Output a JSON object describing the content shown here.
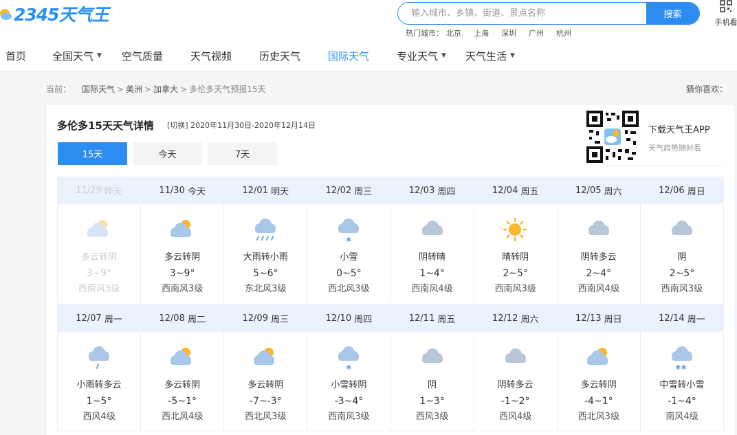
{
  "logo": {
    "text": "2345天气王"
  },
  "search": {
    "placeholder": "输入城市、乡镇、街道、景点名称",
    "button": "搜索"
  },
  "hot_cities": {
    "label": "热门城市：",
    "items": [
      "北京",
      "上海",
      "深圳",
      "广州",
      "杭州"
    ]
  },
  "mobile": {
    "label": "手机看"
  },
  "nav": {
    "items": [
      {
        "label": "首页",
        "caret": false,
        "active": false
      },
      {
        "label": "全国天气",
        "caret": true,
        "active": false
      },
      {
        "label": "空气质量",
        "caret": false,
        "active": false
      },
      {
        "label": "天气视频",
        "caret": false,
        "active": false
      },
      {
        "label": "历史天气",
        "caret": false,
        "active": false
      },
      {
        "label": "国际天气",
        "caret": false,
        "active": true
      },
      {
        "label": "专业天气",
        "caret": true,
        "active": false
      },
      {
        "label": "天气生活",
        "caret": true,
        "active": false
      }
    ]
  },
  "breadcrumb": {
    "prefix": "当前：",
    "items": [
      "国际天气",
      "美洲",
      "加拿大"
    ],
    "current": "多伦多天气预报15天"
  },
  "guess": "猜你喜欢：",
  "page": {
    "title": "多伦多15天天气详情",
    "switch": "[切换]",
    "range": "2020年11月30日-2020年12月14日"
  },
  "tabs": [
    {
      "label": "15天",
      "active": true
    },
    {
      "label": "今天",
      "active": false
    },
    {
      "label": "7天",
      "active": false
    }
  ],
  "app": {
    "download": "下载天气王APP",
    "sub": "天气趋势随时看"
  },
  "colors": {
    "accent": "#2d8cf0",
    "header_bg": "#eaf3fd",
    "sun": "#f7b731",
    "cloud": "#b7ccdf"
  },
  "days": [
    {
      "date": "11/29",
      "week": "昨天",
      "desc": "多云转阴",
      "temp": "3~9°",
      "wind": "西南风3级",
      "icon": "partly-cloudy",
      "past": true
    },
    {
      "date": "11/30",
      "week": "今天",
      "desc": "多云转阴",
      "temp": "3~9°",
      "wind": "西南风3级",
      "icon": "partly-cloudy"
    },
    {
      "date": "12/01",
      "week": "明天",
      "desc": "大雨转小雨",
      "temp": "5~6°",
      "wind": "东北风3级",
      "icon": "heavy-rain"
    },
    {
      "date": "12/02",
      "week": "周三",
      "desc": "小雪",
      "temp": "0~5°",
      "wind": "西北风3级",
      "icon": "light-snow"
    },
    {
      "date": "12/03",
      "week": "周四",
      "desc": "阴转晴",
      "temp": "1~4°",
      "wind": "西南风4级",
      "icon": "overcast"
    },
    {
      "date": "12/04",
      "week": "周五",
      "desc": "晴转阴",
      "temp": "2~5°",
      "wind": "西南风3级",
      "icon": "sunny"
    },
    {
      "date": "12/05",
      "week": "周六",
      "desc": "阴转多云",
      "temp": "2~4°",
      "wind": "西南风4级",
      "icon": "overcast"
    },
    {
      "date": "12/06",
      "week": "周日",
      "desc": "阴",
      "temp": "2~5°",
      "wind": "西南风3级",
      "icon": "overcast"
    },
    {
      "date": "12/07",
      "week": "周一",
      "desc": "小雨转多云",
      "temp": "1~5°",
      "wind": "西风4级",
      "icon": "light-rain"
    },
    {
      "date": "12/08",
      "week": "周二",
      "desc": "多云转阴",
      "temp": "-5~1°",
      "wind": "西北风4级",
      "icon": "partly-cloudy"
    },
    {
      "date": "12/09",
      "week": "周三",
      "desc": "多云转阴",
      "temp": "-7~-3°",
      "wind": "西北风3级",
      "icon": "partly-cloudy"
    },
    {
      "date": "12/10",
      "week": "周四",
      "desc": "小雪转阴",
      "temp": "-3~4°",
      "wind": "西南风3级",
      "icon": "light-snow"
    },
    {
      "date": "12/11",
      "week": "周五",
      "desc": "阴",
      "temp": "1~3°",
      "wind": "西风3级",
      "icon": "overcast"
    },
    {
      "date": "12/12",
      "week": "周六",
      "desc": "阴转多云",
      "temp": "-1~2°",
      "wind": "西风4级",
      "icon": "overcast"
    },
    {
      "date": "12/13",
      "week": "周日",
      "desc": "多云转阴",
      "temp": "-4~1°",
      "wind": "西北风3级",
      "icon": "partly-cloudy"
    },
    {
      "date": "12/14",
      "week": "周一",
      "desc": "中雪转小雪",
      "temp": "-1~4°",
      "wind": "南风4级",
      "icon": "moderate-snow"
    }
  ]
}
